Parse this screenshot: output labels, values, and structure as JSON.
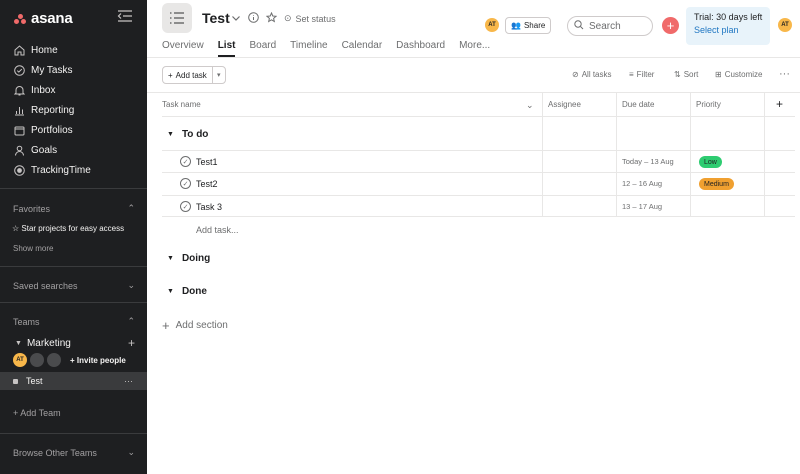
{
  "sidebar": {
    "logo_text": "asana",
    "nav": [
      {
        "label": "Home",
        "icon": "home-icon"
      },
      {
        "label": "My Tasks",
        "icon": "check-circle-icon"
      },
      {
        "label": "Inbox",
        "icon": "bell-icon"
      },
      {
        "label": "Reporting",
        "icon": "chart-icon"
      },
      {
        "label": "Portfolios",
        "icon": "folder-icon"
      },
      {
        "label": "Goals",
        "icon": "person-icon"
      },
      {
        "label": "TrackingTime",
        "icon": "app-icon"
      }
    ],
    "favorites_label": "Favorites",
    "star_projects": "☆ Star projects for easy access",
    "show_more": "Show more",
    "saved_searches": "Saved searches",
    "teams_label": "Teams",
    "team_name": "Marketing",
    "member_initials": "AT",
    "invite_people": "Invite people",
    "project_name": "Test",
    "add_team": "+ Add Team",
    "browse_teams": "Browse Other Teams"
  },
  "header": {
    "project_title": "Test",
    "set_status": "Set status",
    "avatar_initials": "AT",
    "share": "Share",
    "search_placeholder": "Search",
    "trial_text": "Trial: 30 days left",
    "select_plan": "Select plan",
    "tabs": [
      "Overview",
      "List",
      "Board",
      "Timeline",
      "Calendar",
      "Dashboard",
      "More..."
    ],
    "active_tab": "List"
  },
  "toolbar": {
    "add_task": "Add task",
    "all_tasks": "All tasks",
    "filter": "Filter",
    "sort": "Sort",
    "customize": "Customize"
  },
  "table": {
    "columns": [
      "Task name",
      "Assignee",
      "Due date",
      "Priority"
    ],
    "sections": [
      {
        "name": "To do"
      },
      {
        "name": "Doing"
      },
      {
        "name": "Done"
      }
    ],
    "tasks": [
      {
        "name": "Test1",
        "due": "Today – 13 Aug",
        "priority": "Low",
        "priority_color": "#2ecc71"
      },
      {
        "name": "Test2",
        "due": "12 – 16 Aug",
        "priority": "Medium",
        "priority_color": "#f0a030"
      },
      {
        "name": "Task 3",
        "due": "13 – 17 Aug",
        "priority": ""
      }
    ],
    "add_task_inline": "Add task...",
    "add_section": "Add section"
  }
}
